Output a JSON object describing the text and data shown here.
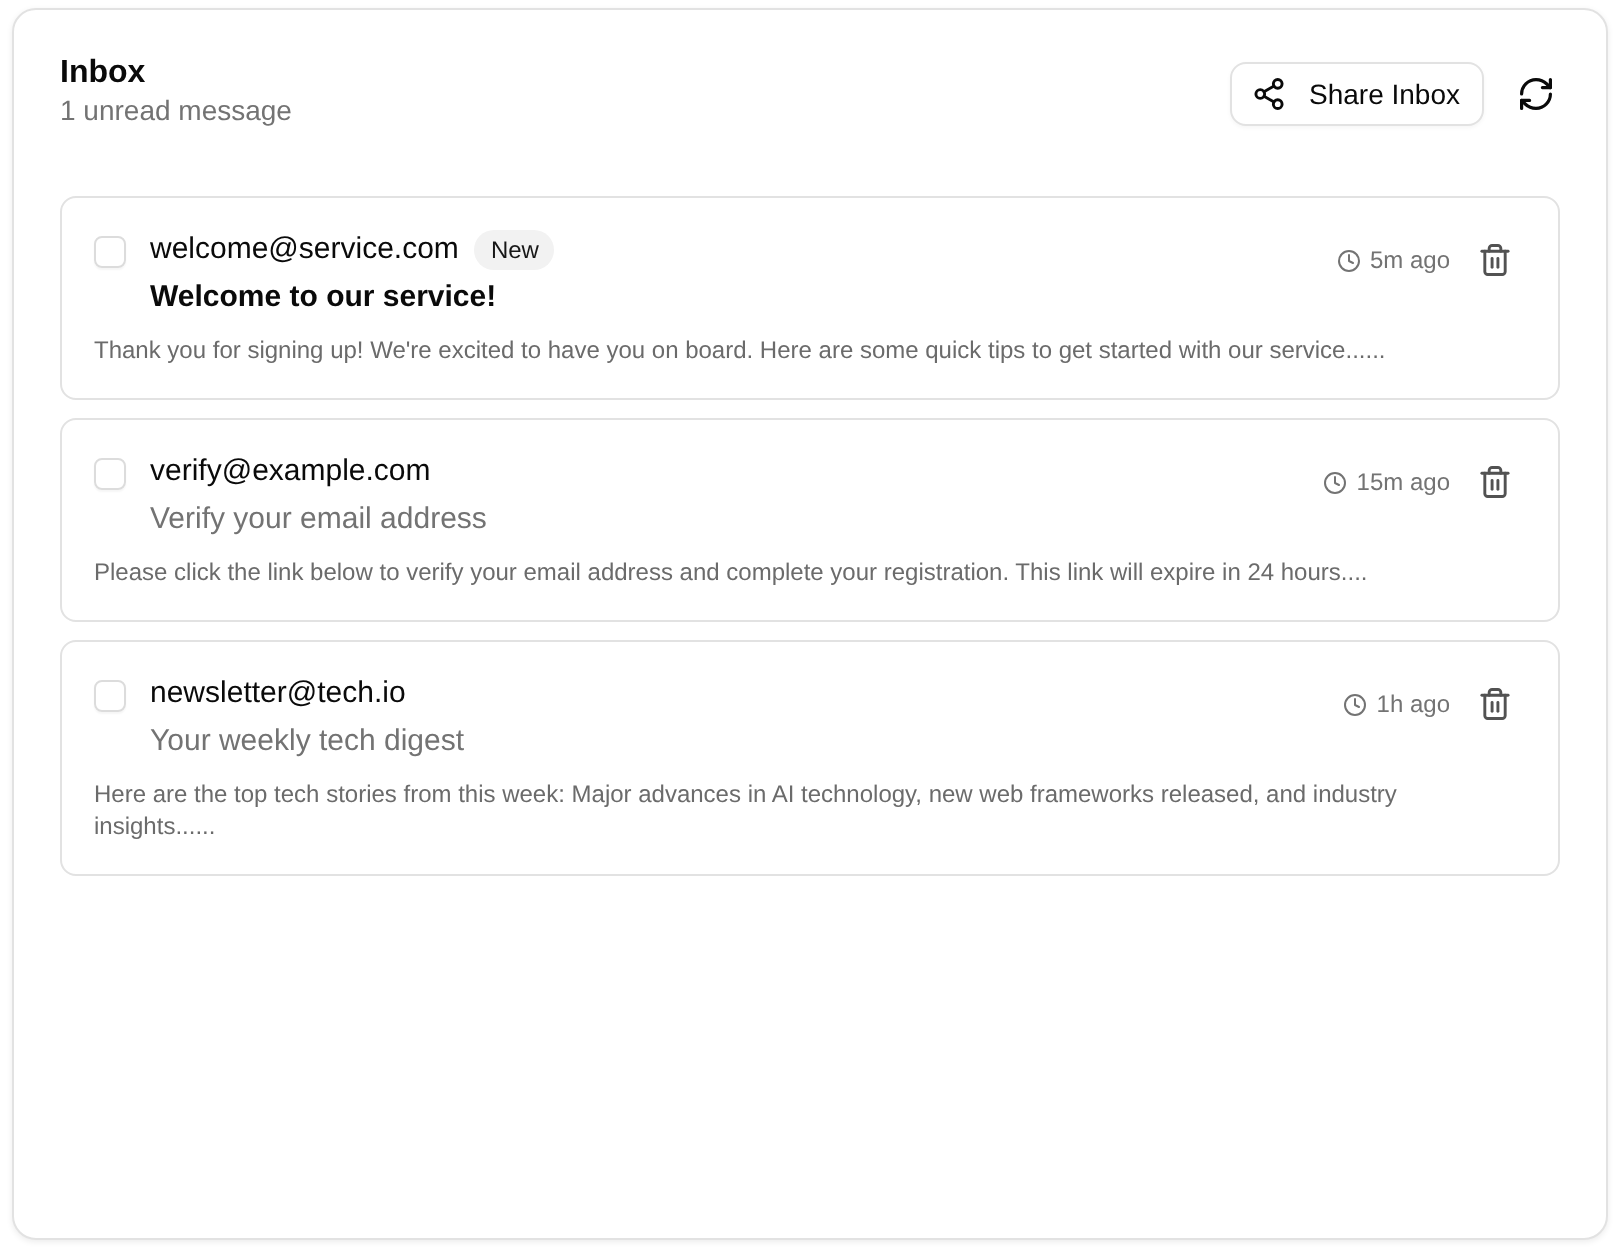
{
  "header": {
    "title": "Inbox",
    "subtitle": "1 unread message"
  },
  "actions": {
    "share_button": "Share Inbox"
  },
  "messages": [
    {
      "sender": "welcome@service.com",
      "badge": "New",
      "subject": "Welcome to our service!",
      "unread": true,
      "checked": false,
      "time": "5m ago",
      "preview": "Thank you for signing up! We're excited to have you on board. Here are some quick tips to get started with our service......"
    },
    {
      "sender": "verify@example.com",
      "subject": "Verify your email address",
      "unread": false,
      "checked": false,
      "time": "15m ago",
      "preview": "Please click the link below to verify your email address and complete your registration. This link will expire in 24 hours...."
    },
    {
      "sender": "newsletter@tech.io",
      "subject": "Your weekly tech digest",
      "unread": false,
      "checked": false,
      "time": "1h ago",
      "preview": "Here are the top tech stories from this week: Major advances in AI technology, new web frameworks released, and industry insights......"
    }
  ]
}
